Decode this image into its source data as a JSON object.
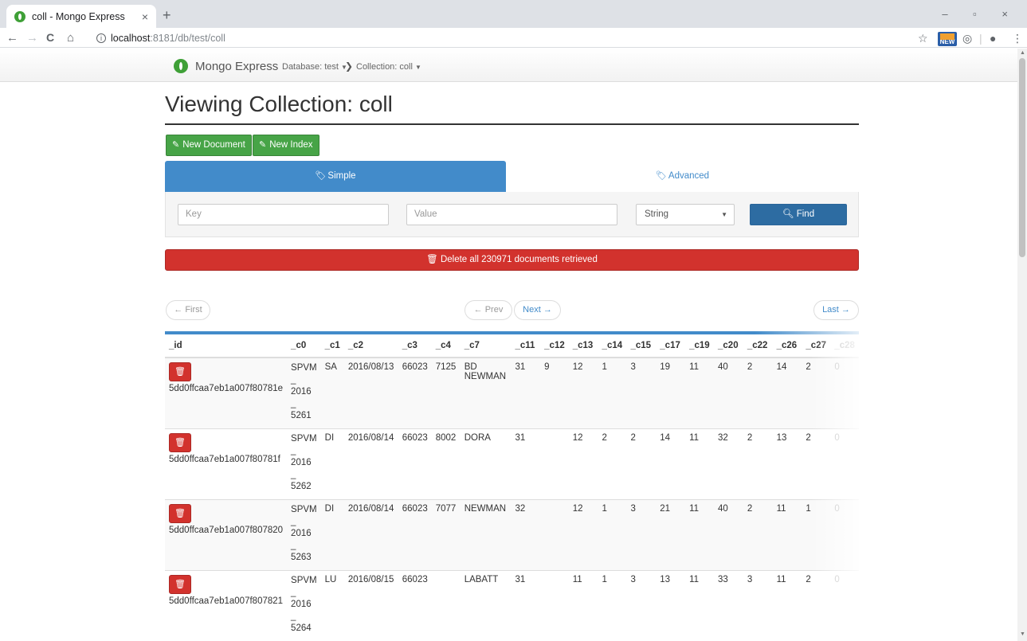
{
  "browser": {
    "tab_title": "coll - Mongo Express",
    "tab_close": "×",
    "new_tab": "+",
    "back": "←",
    "forward": "→",
    "reload": "C",
    "home": "⌂",
    "url_host": "localhost",
    "url_path": ":8181/db/test/coll",
    "win_controls": "– ▫ ×"
  },
  "navbar": {
    "brand": "Mongo Express",
    "database_crumb": "Database: test",
    "collection_crumb": "Collection: coll"
  },
  "page": {
    "title": "Viewing Collection: coll",
    "new_document": "New Document",
    "new_index": "New Index",
    "tab_simple": "Simple",
    "tab_advanced": "Advanced",
    "key_placeholder": "Key",
    "value_placeholder": "Value",
    "type_selected": "String",
    "find_label": "Find",
    "delete_all_label": "Delete all 230971 documents retrieved"
  },
  "pagination": {
    "first": "← First",
    "prev": "← Prev",
    "next": "Next →",
    "last": "Last →"
  },
  "table": {
    "columns": [
      "_id",
      "_c0",
      "_c1",
      "_c2",
      "_c3",
      "_c4",
      "_c7",
      "_c11",
      "_c12",
      "_c13",
      "_c14",
      "_c15",
      "_c17",
      "_c19",
      "_c20",
      "_c22",
      "_c26",
      "_c27",
      "_c28"
    ],
    "rows": [
      {
        "id": "5dd0ffcaa7eb1a007f80781e",
        "c0": [
          "SPVM",
          "_",
          "2016",
          "_",
          "5261"
        ],
        "c1": "SA",
        "c2": "2016/08/13",
        "c3": "66023",
        "c4": "7125",
        "c7": [
          "BD",
          "NEWMAN"
        ],
        "c11": "31",
        "c12": "9",
        "c13": "12",
        "c14": "1",
        "c15": "3",
        "c17": "19",
        "c19": "11",
        "c20": "40",
        "c22": "2",
        "c26": "14",
        "c27": "2",
        "c28": "0"
      },
      {
        "id": "5dd0ffcaa7eb1a007f80781f",
        "c0": [
          "SPVM",
          "_",
          "2016",
          "_",
          "5262"
        ],
        "c1": "DI",
        "c2": "2016/08/14",
        "c3": "66023",
        "c4": "8002",
        "c7": [
          "DORA",
          ""
        ],
        "c11": "31",
        "c12": "",
        "c13": "12",
        "c14": "2",
        "c15": "2",
        "c17": "14",
        "c19": "11",
        "c20": "32",
        "c22": "2",
        "c26": "13",
        "c27": "2",
        "c28": "0"
      },
      {
        "id": "5dd0ffcaa7eb1a007f807820",
        "c0": [
          "SPVM",
          "_",
          "2016",
          "_",
          "5263"
        ],
        "c1": "DI",
        "c2": "2016/08/14",
        "c3": "66023",
        "c4": "7077",
        "c7": [
          "NEWMAN",
          ""
        ],
        "c11": "32",
        "c12": "",
        "c13": "12",
        "c14": "1",
        "c15": "3",
        "c17": "21",
        "c19": "11",
        "c20": "40",
        "c22": "2",
        "c26": "11",
        "c27": "1",
        "c28": "0"
      },
      {
        "id": "5dd0ffcaa7eb1a007f807821",
        "c0": [
          "SPVM",
          "_",
          "2016",
          "_",
          "5264"
        ],
        "c1": "LU",
        "c2": "2016/08/15",
        "c3": "66023",
        "c4": "",
        "c7": [
          "LABATT",
          ""
        ],
        "c11": "31",
        "c12": "",
        "c13": "11",
        "c14": "1",
        "c15": "3",
        "c17": "13",
        "c19": "11",
        "c20": "33",
        "c22": "3",
        "c26": "11",
        "c27": "2",
        "c28": "0"
      }
    ]
  }
}
